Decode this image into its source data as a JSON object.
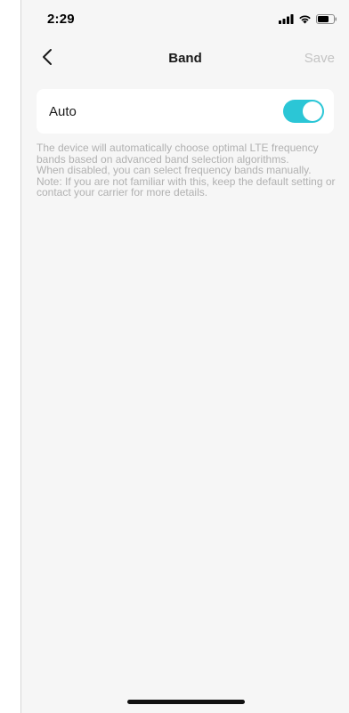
{
  "status_bar": {
    "time": "2:29",
    "icons": [
      "cellular-signal-icon",
      "wifi-icon",
      "battery-icon"
    ]
  },
  "nav": {
    "title": "Band",
    "save_label": "Save",
    "back_icon": "chevron-left-icon"
  },
  "setting": {
    "label": "Auto",
    "toggle_on": true,
    "toggle_color": "#2bc6d6"
  },
  "description": {
    "line1": "The device will automatically choose optimal LTE frequency bands based on advanced band selection algorithms.",
    "line2": "When disabled, you can select frequency bands manually.",
    "line3": "Note: If you are not familiar with this, keep the default setting or contact your carrier for more details."
  },
  "colors": {
    "accent": "#2bc6d6",
    "background": "#f6f6f6",
    "card": "#ffffff",
    "muted_text": "#b1b1b1",
    "disabled_text": "#c4c4c4"
  }
}
